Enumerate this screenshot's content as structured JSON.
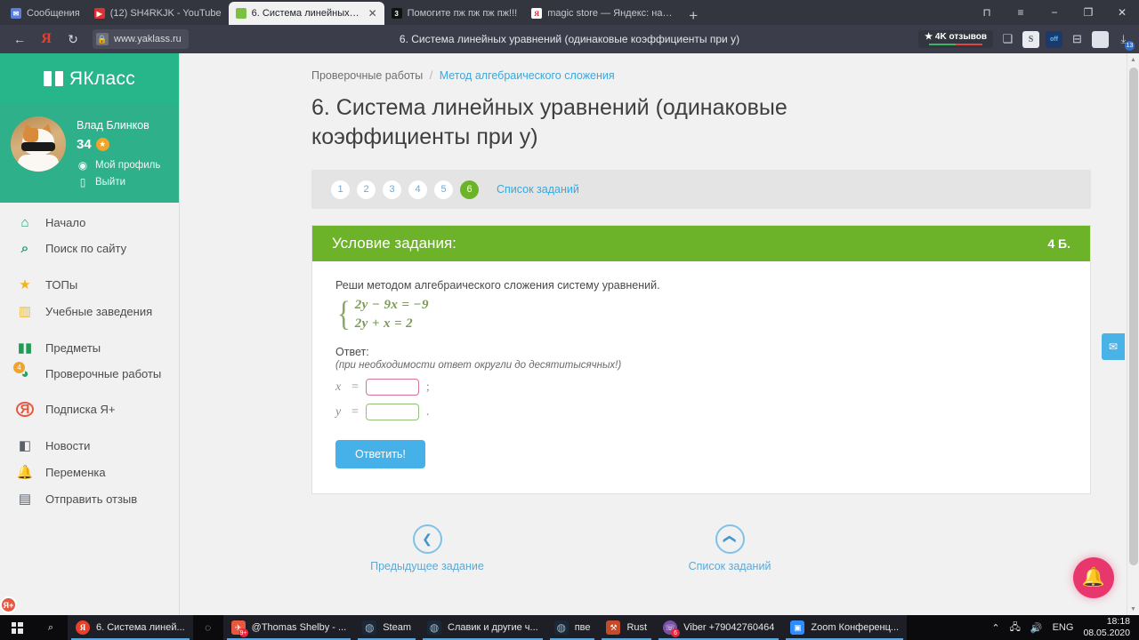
{
  "browser": {
    "tabs": [
      {
        "title": "Сообщения",
        "favicon": "messages-icon",
        "active": false
      },
      {
        "title": "(12) SH4RKJK - YouTube",
        "favicon": "youtube-icon",
        "active": false
      },
      {
        "title": "6. Система линейных ур...",
        "favicon": "yaklass-icon",
        "active": true
      },
      {
        "title": "Помогите пж пж пж пж!!!",
        "favicon": "3",
        "active": false
      },
      {
        "title": "magic store — Яндекс: наш...",
        "favicon": "yandex-icon",
        "active": false
      }
    ],
    "new_tab_label": "+",
    "window_controls": {
      "collections": "⊓",
      "menu": "≡",
      "minimize": "−",
      "maximize": "❐",
      "close": "✕"
    },
    "nav": {
      "back": "←",
      "yandex_logo": "Я",
      "reload": "↻"
    },
    "omnibox": {
      "lock": "🔒",
      "url": "www.yaklass.ru"
    },
    "page_title": "6. Система линейных уравнений (одинаковые коэффициенты при y)",
    "reviews_badge": {
      "text": "★ 4K отзывов",
      "green": "#3db36a",
      "red": "#e04545"
    },
    "extensions": [
      {
        "name": "bookmark-icon",
        "glyph": "❏"
      },
      {
        "name": "savefrom-icon",
        "glyph": "S"
      },
      {
        "name": "adblock-off-icon",
        "glyph": "off"
      },
      {
        "name": "tag-icon",
        "glyph": "⊟"
      },
      {
        "name": "document-icon",
        "glyph": ""
      },
      {
        "name": "downloads-icon",
        "glyph": "⤓",
        "badge": "13"
      }
    ]
  },
  "sidebar": {
    "brand": "ЯКласс",
    "user": {
      "name": "Влад Блинков",
      "points": "34",
      "points_icon": "star-icon",
      "subscription_badge": "Я+",
      "links": [
        {
          "label": "Мой профиль",
          "icon": "profile-icon",
          "glyph": "◉"
        },
        {
          "label": "Выйти",
          "icon": "logout-icon",
          "glyph": "▯"
        }
      ]
    },
    "items": [
      {
        "label": "Начало",
        "icon": "home-icon",
        "glyph": "⌂",
        "cls": "ic-home"
      },
      {
        "label": "Поиск по сайту",
        "icon": "search-icon",
        "glyph": "⌕",
        "cls": "ic-search"
      },
      {
        "gap": true
      },
      {
        "label": "ТОПы",
        "icon": "star-icon",
        "glyph": "★",
        "cls": "ic-star"
      },
      {
        "label": "Учебные заведения",
        "icon": "institution-icon",
        "glyph": "🏛",
        "cls": "ic-bank"
      },
      {
        "gap": true
      },
      {
        "label": "Предметы",
        "icon": "books-icon",
        "glyph": "▮▮",
        "cls": "ic-books"
      },
      {
        "label": "Проверочные работы",
        "icon": "checks-icon",
        "glyph": "◔",
        "cls": "ic-checks",
        "count": "4"
      },
      {
        "gap": true
      },
      {
        "label": "Подписка Я+",
        "icon": "subscription-icon",
        "glyph": "Я+",
        "cls": "ic-sub"
      },
      {
        "gap": true
      },
      {
        "label": "Новости",
        "icon": "megaphone-icon",
        "glyph": "📢",
        "cls": "ic-news"
      },
      {
        "label": "Переменка",
        "icon": "bell-icon",
        "glyph": "🔔",
        "cls": "ic-bell"
      },
      {
        "label": "Отправить отзыв",
        "icon": "feedback-icon",
        "glyph": "🗨",
        "cls": "ic-feedback"
      }
    ]
  },
  "main": {
    "breadcrumb": {
      "root": "Проверочные работы",
      "sep": "/",
      "current": "Метод алгебраического сложения"
    },
    "title": "6. Система линейных уравнений (одинаковые коэффициенты при y)",
    "steps": {
      "numbers": [
        "1",
        "2",
        "3",
        "4",
        "5",
        "6"
      ],
      "current": "6",
      "tasklist_link": "Список заданий"
    },
    "card": {
      "header_title": "Условие задания:",
      "score": "4 Б.",
      "instruction": "Реши методом алгебраического сложения систему уравнений.",
      "equations": [
        "2y − 9x = −9",
        "2y + x = 2"
      ],
      "answer_label": "Ответ:",
      "answer_note": "(при необходимости ответ округли до десятитысячных!)",
      "fields": [
        {
          "var": "x",
          "sign": "=",
          "value": "",
          "punct": ";",
          "state": "focused"
        },
        {
          "var": "y",
          "sign": "=",
          "value": "",
          "punct": ".",
          "state": "normal"
        }
      ],
      "submit_label": "Ответить!"
    },
    "footer_nav": [
      {
        "label": "Предыдущее задание",
        "icon": "chevron-left-icon",
        "glyph": "❮"
      },
      {
        "label": "Список заданий",
        "icon": "chevron-up-icon",
        "glyph": "❮"
      }
    ],
    "feedback_tab_icon": "envelope-icon",
    "bell_fab_icon": "bell-icon"
  },
  "taskbar": {
    "start_icon": "windows-start-icon",
    "search_icon": "search-icon",
    "items": [
      {
        "label": "6. Система линей...",
        "icon": "yandex-browser-icon",
        "running": true
      },
      {
        "label": "",
        "icon": "cortana-icon",
        "running": false
      },
      {
        "label": "@Thomas Shelby - ...",
        "icon": "telegram-icon",
        "running": true,
        "count": "9+"
      },
      {
        "label": "Steam",
        "icon": "steam-icon",
        "running": true
      },
      {
        "label": "Славик и другие ч...",
        "icon": "steam-icon",
        "running": true
      },
      {
        "label": "пве",
        "icon": "steam-icon",
        "running": true
      },
      {
        "label": "Rust",
        "icon": "rust-icon",
        "running": true
      },
      {
        "label": "Viber +79042760464",
        "icon": "viber-icon",
        "running": true,
        "count": "6"
      },
      {
        "label": "Zoom Конференц...",
        "icon": "zoom-icon",
        "running": true
      }
    ],
    "tray": {
      "expand": "⌃",
      "network": "🖧",
      "volume": "🔊",
      "lang": "ENG"
    },
    "clock": {
      "time": "18:18",
      "date": "08.05.2020"
    }
  }
}
